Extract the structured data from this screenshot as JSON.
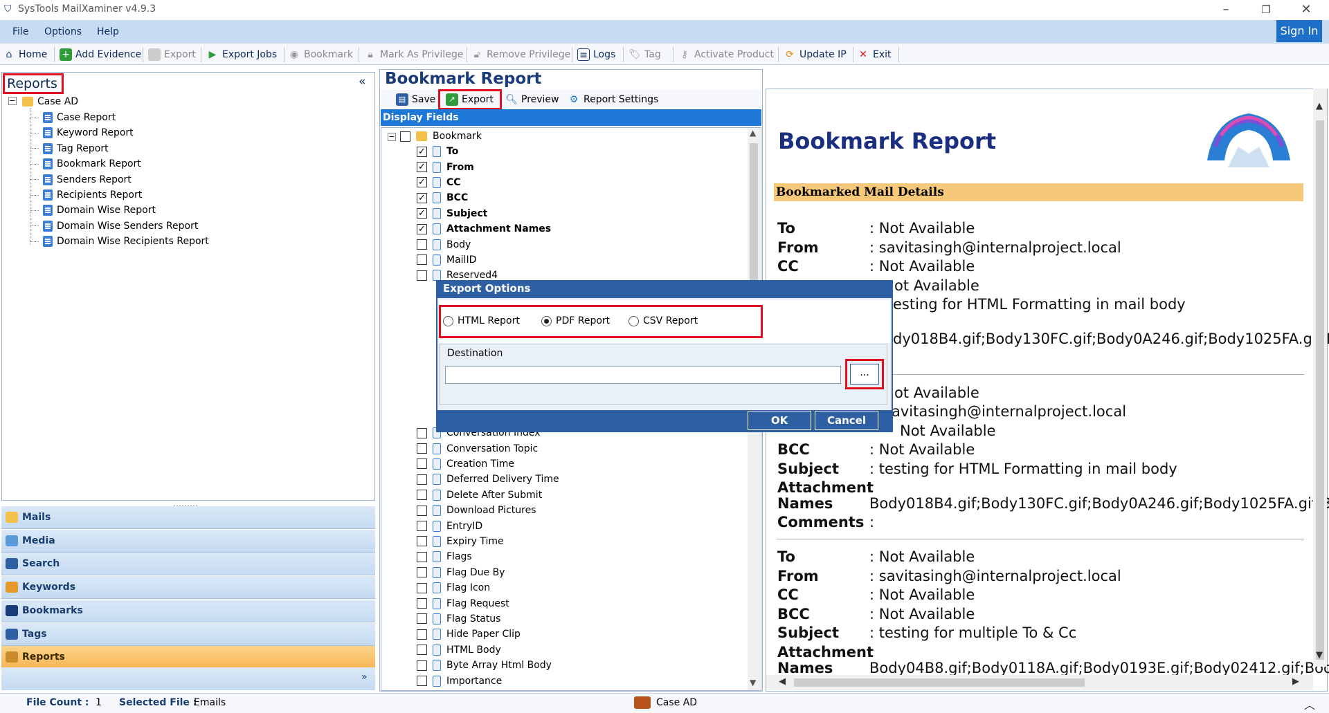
{
  "app": {
    "title": "SysTools MailXaminer v4.9.3"
  },
  "menu": {
    "file": "File",
    "options": "Options",
    "help": "Help",
    "signin": "Sign In"
  },
  "toolbar": {
    "home": "Home",
    "add_evidence": "Add Evidence",
    "export": "Export",
    "export_jobs": "Export Jobs",
    "bookmark": "Bookmark",
    "mark_as_privilege": "Mark As Privilege",
    "remove_privilege": "Remove Privilege",
    "logs": "Logs",
    "tag": "Tag",
    "activate_product": "Activate Product",
    "update_ip": "Update IP",
    "exit": "Exit"
  },
  "left": {
    "title": "Reports",
    "collapse": "«",
    "root": "Case AD",
    "items": [
      "Case Report",
      "Keyword Report",
      "Tag Report",
      "Bookmark Report",
      "Senders Report",
      "Recipients Report",
      "Domain Wise Report",
      "Domain Wise Senders Report",
      "Domain Wise Recipients Report"
    ],
    "nav": [
      "Mails",
      "Media",
      "Search",
      "Keywords",
      "Bookmarks",
      "Tags",
      "Reports"
    ],
    "nav_active": "Reports"
  },
  "middle": {
    "title": "Bookmark Report",
    "save": "Save",
    "export": "Export",
    "preview": "Preview",
    "report_settings": "Report Settings",
    "display_fields": "Display Fields",
    "root": "Bookmark",
    "fields_top": [
      {
        "label": "To",
        "checked": true,
        "bold": true
      },
      {
        "label": "From",
        "checked": true,
        "bold": true
      },
      {
        "label": "CC",
        "checked": true,
        "bold": true
      },
      {
        "label": "BCC",
        "checked": true,
        "bold": true
      },
      {
        "label": "Subject",
        "checked": true,
        "bold": true
      },
      {
        "label": "Attachment Names",
        "checked": true,
        "bold": true
      },
      {
        "label": "Body",
        "checked": false,
        "bold": false
      },
      {
        "label": "MailID",
        "checked": false,
        "bold": false
      },
      {
        "label": "Reserved4",
        "checked": false,
        "bold": false
      }
    ],
    "fields_bottom": [
      "Conversation Index",
      "Conversation Topic",
      "Creation Time",
      "Deferred Delivery Time",
      "Delete After Submit",
      "Download Pictures",
      "EntryID",
      "Expiry Time",
      "Flags",
      "Flag Due By",
      "Flag Icon",
      "Flag Request",
      "Flag Status",
      "Hide Paper Clip",
      "HTML Body",
      "Byte Array Html Body",
      "Importance"
    ]
  },
  "dialog": {
    "title": "Export Options",
    "html_report": "HTML Report",
    "pdf_report": "PDF Report",
    "csv_report": "CSV Report",
    "selected": "PDF Report",
    "destination": "Destination",
    "destination_value": "",
    "browse": "...",
    "ok": "OK",
    "cancel": "Cancel"
  },
  "preview": {
    "title": "Bookmark Report",
    "section": "Bookmarked Mail Details",
    "record1": {
      "to_lab": "To",
      "to": ": Not Available",
      "from_lab": "From",
      "from": ": savitasingh@internalproject.local",
      "cc_lab": "CC",
      "cc": ": Not Available",
      "bcc_partial": "ot Available",
      "subject_partial": "esting for HTML Formatting in mail body",
      "attach_partial": "dy018B4.gif;Body130FC.gif;Body0A246.gif;Body1025FA.gif;B"
    },
    "record2": {
      "to_partial": "ot Available",
      "from_partial": "avitasingh@internalproject.local",
      "cc_partial": "Not Available",
      "bcc_lab": "BCC",
      "bcc": ": Not Available",
      "subject_lab": "Subject",
      "subject": ": testing for HTML Formatting in mail body",
      "attach_lab1": "Attachment",
      "attach_colon": ":",
      "attach_lab2": "Names",
      "attach": "Body018B4.gif;Body130FC.gif;Body0A246.gif;Body1025FA.gif;B",
      "comments_lab": "Comments",
      "comments": ":"
    },
    "record3": {
      "to_lab": "To",
      "to": ": Not Available",
      "from_lab": "From",
      "from": ": savitasingh@internalproject.local",
      "cc_lab": "CC",
      "cc": ": Not Available",
      "bcc_lab": "BCC",
      "bcc": ": Not Available",
      "subject_lab": "Subject",
      "subject": ": testing for multiple To & Cc",
      "attach_lab1": "Attachment",
      "attach_colon": ":",
      "attach_lab2": "Names",
      "attach": "Body04B8.gif;Body0118A.gif;Body0193E.gif;Body02412.gif;Boo"
    }
  },
  "status": {
    "file_count_label": "File Count :",
    "file_count": "1",
    "selected_file_label": "Selected File :",
    "selected_file": "Emails",
    "case": "Case AD"
  },
  "colors": {
    "accent": "#1e78d7",
    "highlight_red": "#e01020",
    "nav_active": "#f8b656"
  }
}
